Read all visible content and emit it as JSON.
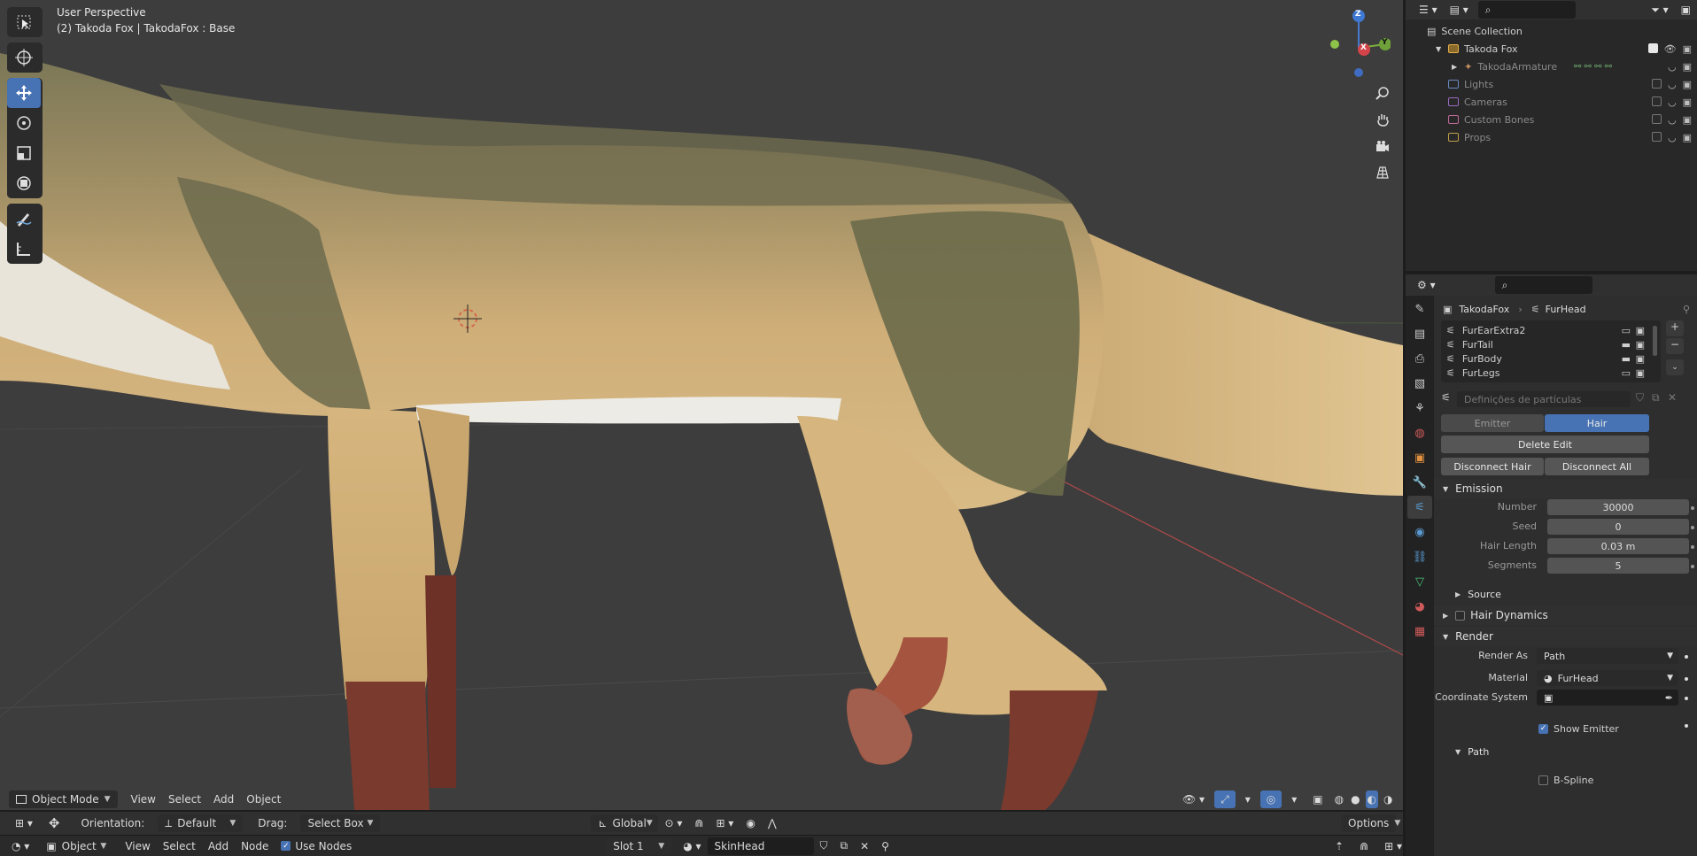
{
  "viewport": {
    "perspective_label": "User Perspective",
    "object_label": "(2) Takoda Fox | TakodaFox : Base",
    "gizmo": {
      "z": "Z",
      "y": "Y",
      "x": "X"
    }
  },
  "toolbar_tools": [
    "cursor-select",
    "cursor-3d",
    "move",
    "rotate",
    "scale",
    "transform",
    "annotate",
    "measure"
  ],
  "viewport_header": {
    "mode": "Object Mode",
    "menu": [
      "View",
      "Select",
      "Add",
      "Object"
    ]
  },
  "tool_settings": {
    "orientation_label": "Orientation:",
    "orientation_value": "Default",
    "drag_label": "Drag:",
    "drag_value": "Select Box",
    "transform_orientation": "Global",
    "options": "Options"
  },
  "node_header": {
    "type": "Object",
    "menu": [
      "View",
      "Select",
      "Add",
      "Node"
    ],
    "use_nodes_label": "Use Nodes",
    "slot": "Slot 1",
    "material": "SkinHead"
  },
  "outliner": {
    "items": [
      {
        "label": "Scene Collection",
        "depth": 0
      },
      {
        "label": "Takoda Fox",
        "depth": 1
      },
      {
        "label": "TakodaArmature",
        "depth": 2
      },
      {
        "label": "Lights",
        "depth": 1
      },
      {
        "label": "Cameras",
        "depth": 1
      },
      {
        "label": "Custom Bones",
        "depth": 1
      },
      {
        "label": "Props",
        "depth": 1
      }
    ]
  },
  "properties": {
    "breadcrumb_object": "TakodaFox",
    "breadcrumb_system": "FurHead",
    "particle_systems": [
      "FurEarExtra2",
      "FurTail",
      "FurBody",
      "FurLegs"
    ],
    "settings_placeholder": "Definições de partículas",
    "type_emitter": "Emitter",
    "type_hair": "Hair",
    "delete_edit": "Delete Edit",
    "disconnect_hair": "Disconnect Hair",
    "disconnect_all": "Disconnect All",
    "emission": {
      "title": "Emission",
      "number_label": "Number",
      "number_value": "30000",
      "seed_label": "Seed",
      "seed_value": "0",
      "hair_length_label": "Hair Length",
      "hair_length_value": "0.03 m",
      "segments_label": "Segments",
      "segments_value": "5"
    },
    "source_title": "Source",
    "hair_dynamics_title": "Hair Dynamics",
    "render": {
      "title": "Render",
      "render_as_label": "Render As",
      "render_as_value": "Path",
      "material_label": "Material",
      "material_value": "FurHead",
      "coordinate_system_label": "Coordinate System",
      "show_emitter_label": "Show Emitter",
      "path_title": "Path",
      "bspline_label": "B-Spline"
    }
  },
  "colors": {
    "accent": "#4772b3",
    "viewport_bg": "#3d3d3d",
    "fur_light": "#c8a572",
    "fur_dark": "#6b6a4a",
    "paw": "#7a3a2e"
  }
}
